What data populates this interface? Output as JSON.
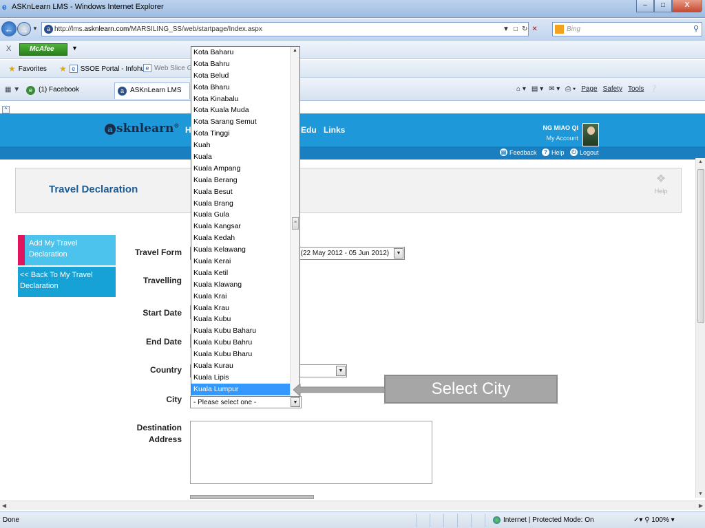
{
  "browser": {
    "window_title": "ASKnLearn LMS - Windows Internet Explorer",
    "url_prefix": "http://lms.",
    "url_domain": "asknlearn.com",
    "url_path": "/MARSILING_SS/web/startpage/Index.aspx",
    "search_placeholder": "Bing",
    "mcafee_label": "McAfee",
    "favorites_label": "Favorites",
    "fav_links": [
      "SSOE Portal - Infohub",
      "Web Slice Gal"
    ],
    "tabs": [
      "(1) Facebook",
      "ASKnLearn LMS"
    ],
    "command_bar": [
      "Page",
      "Safety",
      "Tools"
    ],
    "status_text": "Done",
    "zone_text": "Internet | Protected Mode: On",
    "zoom_text": "100%"
  },
  "site": {
    "logo_letter": "a",
    "logo_text": "sknlearn",
    "logo_mark": "®",
    "nav": {
      "home_partial": "H",
      "edu_partial": "Edu",
      "links": "Links"
    },
    "user_name": "NG MIAO QI",
    "my_account": "My Account",
    "feedback": "Feedback",
    "help": "Help",
    "logout": "Logout"
  },
  "page": {
    "title": "Travel Declaration",
    "help_label": "Help",
    "sidebar": {
      "add": "Add My Travel Declaration",
      "back": "<< Back To My Travel Declaration"
    },
    "form": {
      "travel_form_label": "Travel Form",
      "travel_form_value": "2) (22 May 2012 - 05 Jun 2012)",
      "travelling_label": "Travelling",
      "start_date_label": "Start Date",
      "end_date_label": "End Date",
      "country_label": "Country",
      "city_label": "City",
      "city_value": "- Please select one -",
      "destination_label_1": "Destination",
      "destination_label_2": "Address"
    }
  },
  "city_dropdown": {
    "items": [
      "Kota Baharu",
      "Kota Bahru",
      "Kota Belud",
      "Kota Bharu",
      "Kota Kinabalu",
      "Kota Kuala Muda",
      "Kota Sarang Semut",
      "Kota Tinggi",
      "Kuah",
      "Kuala",
      "Kuala Ampang",
      "Kuala Berang",
      "Kuala Besut",
      "Kuala Brang",
      "Kuala Gula",
      "Kuala Kangsar",
      "Kuala Kedah",
      "Kuala Kelawang",
      "Kuala Kerai",
      "Kuala Ketil",
      "Kuala Klawang",
      "Kuala Krai",
      "Kuala Krau",
      "Kuala Kubu",
      "Kuala Kubu Baharu",
      "Kuala Kubu Bahru",
      "Kuala Kubu Bharu",
      "Kuala Kurau",
      "Kuala Lipis",
      "Kuala Lumpur"
    ],
    "selected": "Kuala Lumpur"
  },
  "callout": {
    "text": "Select City"
  },
  "colors": {
    "header_blue": "#1e98d8",
    "accent_pink": "#e0145c",
    "selection": "#3399ff"
  }
}
